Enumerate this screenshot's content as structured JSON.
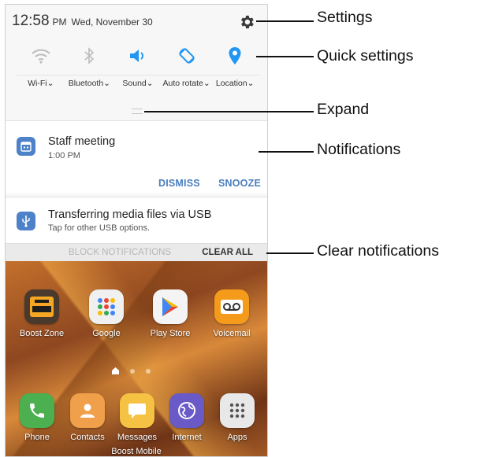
{
  "status_bar": {
    "time": "12:58",
    "ampm": "PM",
    "date": "Wed, November 30"
  },
  "quick_settings": [
    {
      "label": "Wi-Fi",
      "icon": "wifi-icon",
      "active": false
    },
    {
      "label": "Bluetooth",
      "icon": "bluetooth-icon",
      "active": false
    },
    {
      "label": "Sound",
      "icon": "sound-icon",
      "active": true
    },
    {
      "label": "Auto rotate",
      "icon": "auto-rotate-icon",
      "active": true
    },
    {
      "label": "Location",
      "icon": "location-icon",
      "active": true
    }
  ],
  "notifications": [
    {
      "title": "Staff meeting",
      "subtitle": "1:00 PM",
      "icon": "calendar-icon",
      "actions": [
        "DISMISS",
        "SNOOZE"
      ]
    },
    {
      "title": "Transferring media files via USB",
      "subtitle": "Tap for other USB options.",
      "icon": "usb-icon"
    }
  ],
  "notification_bar": {
    "block": "BLOCK NOTIFICATIONS",
    "clear_all": "CLEAR ALL"
  },
  "home_apps_row1": [
    {
      "label": "Boost Zone",
      "icon": "boost-zone-icon"
    },
    {
      "label": "Google",
      "icon": "google-folder-icon"
    },
    {
      "label": "Play Store",
      "icon": "play-store-icon"
    },
    {
      "label": "Voicemail",
      "icon": "voicemail-icon"
    }
  ],
  "dock_apps": [
    {
      "label": "Phone",
      "icon": "phone-icon"
    },
    {
      "label": "Contacts",
      "icon": "contacts-icon"
    },
    {
      "label": "Messages",
      "icon": "messages-icon"
    },
    {
      "label": "Internet",
      "icon": "internet-icon"
    },
    {
      "label": "Apps",
      "icon": "apps-icon"
    }
  ],
  "carrier": "Boost Mobile",
  "callouts": {
    "settings": "Settings",
    "quick_settings": "Quick settings",
    "expand": "Expand",
    "notifications": "Notifications",
    "clear_notifications": "Clear notifications"
  },
  "colors": {
    "accent": "#2196f3",
    "inactive_icon": "#b8b8b8",
    "action_blue": "#4a7fbf",
    "notification_icon": "#4d82c8"
  }
}
